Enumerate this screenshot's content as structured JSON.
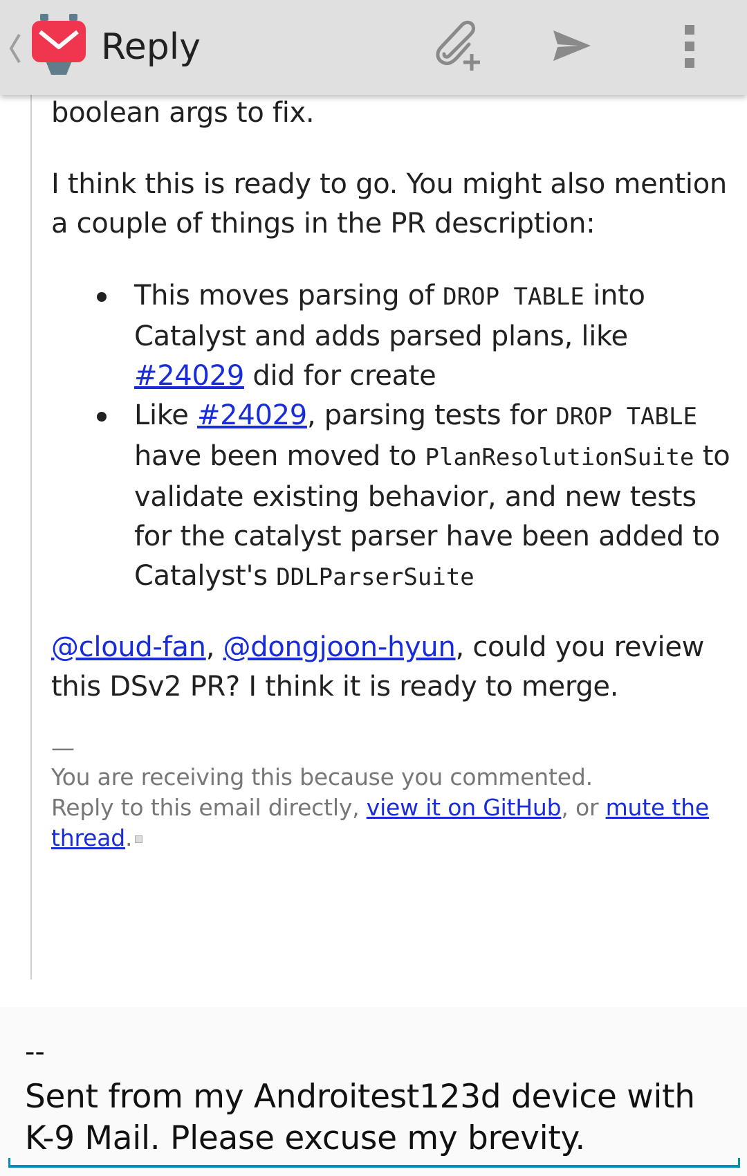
{
  "actionbar": {
    "title": "Reply",
    "icons": {
      "up": "chevron-left-icon",
      "app_logo": "k9-mail-logo-icon",
      "attach": "attach-file-icon",
      "send": "send-icon",
      "overflow": "more-vert-icon"
    },
    "colors": {
      "background": "#e0e0e0",
      "logo_red": "#f0364e",
      "icon_gray": "#8a8a8a"
    }
  },
  "quote": {
    "first_line": "boolean args to fix.",
    "para1": "I think this is ready to go. You might also mention a couple of things in the PR description:",
    "bullets": [
      {
        "t1": "This moves parsing of ",
        "c1": "DROP TABLE",
        "t2": " into Catalyst and adds parsed plans, like ",
        "link": "#24029",
        "t3": " did for create"
      },
      {
        "t1": "Like ",
        "link": "#24029",
        "t2": ", parsing tests for ",
        "c1": "DROP TABLE",
        "t3": " have been moved to ",
        "c2": "PlanResolutionSuite",
        "t4": " to validate existing behavior, and new tests for the catalyst parser have been added to Catalyst's ",
        "c3": "DDLParserSuite"
      }
    ],
    "mention1": "@cloud-fan",
    "sep": ", ",
    "mention2": "@dongjoon-hyun",
    "para3_rest": ", could you review this DSv2 PR? I think it is ready to merge.",
    "footer": {
      "dash": "—",
      "line1": "You are receiving this because you commented.",
      "line2_prefix": "Reply to this email directly, ",
      "link1": "view it on GitHub",
      "middle": ", or ",
      "link2": "mute the thread",
      "end": "."
    },
    "colors": {
      "link": "#1a2cd8",
      "footer_text": "#777777",
      "border": "#cfcfcf"
    }
  },
  "compose": {
    "separator": "--",
    "signature": "Sent from my Androitest123d device with K-9 Mail. Please excuse my brevity.",
    "colors": {
      "underline": "#0091b4"
    }
  }
}
